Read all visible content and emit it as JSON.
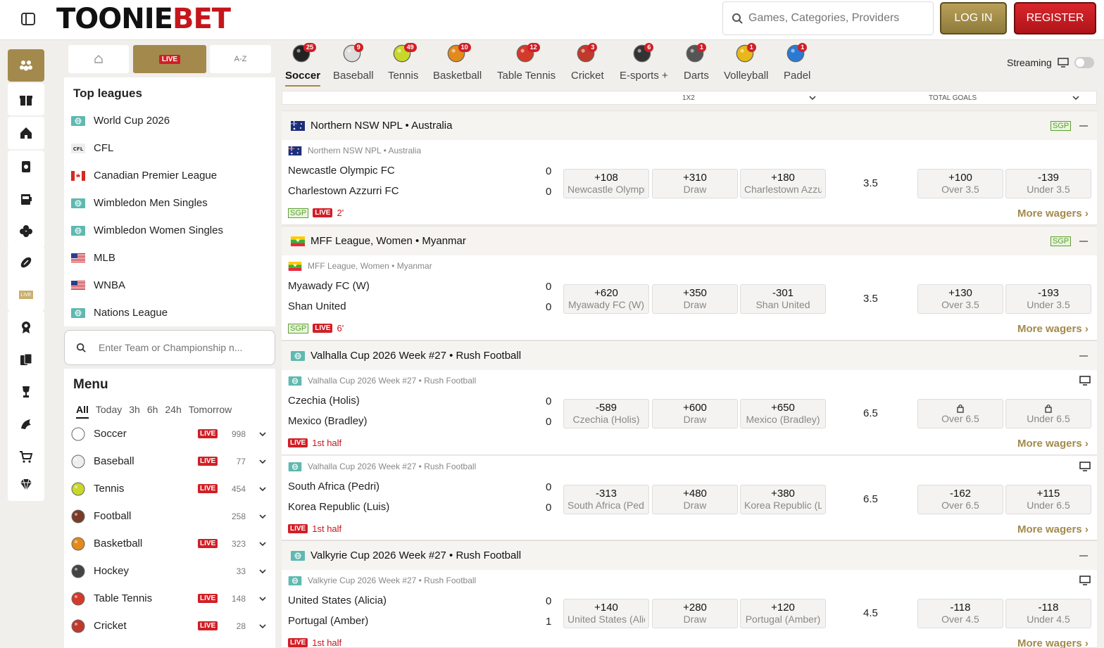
{
  "brand": {
    "logo_dark": "TOONIE",
    "logo_red": "BET"
  },
  "header": {
    "search_placeholder": "Games, Categories, Providers",
    "login_label": "LOG IN",
    "register_label": "REGISTER"
  },
  "left_tabs": {
    "live": "LIVE",
    "az": "A-Z"
  },
  "top_leagues": {
    "title": "Top leagues",
    "items": [
      {
        "label": "World Cup 2026",
        "flag": "globe-icon"
      },
      {
        "label": "CFL",
        "flag": "cfl-icon"
      },
      {
        "label": "Canadian Premier League",
        "flag": "flag-canada"
      },
      {
        "label": "Wimbledon Men Singles",
        "flag": "globe-icon"
      },
      {
        "label": "Wimbledon Women Singles",
        "flag": "globe-icon"
      },
      {
        "label": "MLB",
        "flag": "flag-usa"
      },
      {
        "label": "WNBA",
        "flag": "flag-usa"
      },
      {
        "label": "Nations League",
        "flag": "globe-icon"
      }
    ]
  },
  "team_search": {
    "placeholder": "Enter Team or Championship n..."
  },
  "menu": {
    "title": "Menu",
    "filters": [
      "All",
      "Today",
      "3h",
      "6h",
      "24h",
      "Tomorrow"
    ],
    "live_label": "LIVE",
    "sports": [
      {
        "name": "Soccer",
        "live": true,
        "count": "998",
        "color": "#ffffff"
      },
      {
        "name": "Baseball",
        "live": true,
        "count": "77",
        "color": "#eeeeee"
      },
      {
        "name": "Tennis",
        "live": true,
        "count": "454",
        "color": "#c7d82b"
      },
      {
        "name": "Football",
        "live": false,
        "count": "258",
        "color": "#7a3b2a"
      },
      {
        "name": "Basketball",
        "live": true,
        "count": "323",
        "color": "#e28a1c"
      },
      {
        "name": "Hockey",
        "live": false,
        "count": "33",
        "color": "#444444"
      },
      {
        "name": "Table Tennis",
        "live": true,
        "count": "148",
        "color": "#d33a2a"
      },
      {
        "name": "Cricket",
        "live": true,
        "count": "28",
        "color": "#c0392b"
      }
    ]
  },
  "sport_tabs": [
    {
      "label": "Soccer",
      "badge": "25",
      "color": "#222222"
    },
    {
      "label": "Baseball",
      "badge": "9",
      "color": "#dddddd"
    },
    {
      "label": "Tennis",
      "badge": "49",
      "color": "#c7d82b"
    },
    {
      "label": "Basketball",
      "badge": "10",
      "color": "#e28a1c"
    },
    {
      "label": "Table Tennis",
      "badge": "12",
      "color": "#d33a2a"
    },
    {
      "label": "Cricket",
      "badge": "3",
      "color": "#c0392b"
    },
    {
      "label": "E-sports +",
      "badge": "6",
      "color": "#333333"
    },
    {
      "label": "Darts",
      "badge": "1",
      "color": "#555555"
    },
    {
      "label": "Volleyball",
      "badge": "1",
      "color": "#e8b818"
    },
    {
      "label": "Padel",
      "badge": "1",
      "color": "#2a7ad3"
    }
  ],
  "streaming_label": "Streaming",
  "market_header": {
    "m1": "1X2",
    "m2": "TOTAL GOALS"
  },
  "sections": [
    {
      "title": "Northern NSW NPL • Australia",
      "flag": "flag-australia",
      "sgp": "SGP",
      "events": [
        {
          "sub": "Northern NSW NPL • Australia",
          "home": "Newcastle Olympic FC",
          "away": "Charlestown Azzurri FC",
          "home_score": "0",
          "away_score": "0",
          "odds": [
            {
              "odd": "+108",
              "name": "Newcastle Olympic FC"
            },
            {
              "odd": "+310",
              "name": "Draw"
            },
            {
              "odd": "+180",
              "name": "Charlestown Azzurri FC"
            }
          ],
          "line": "3.5",
          "totals": [
            {
              "odd": "+100",
              "name": "Over 3.5"
            },
            {
              "odd": "-139",
              "name": "Under 3.5"
            }
          ],
          "sgp": "SGP",
          "status": "2'",
          "more": "More wagers ›"
        }
      ]
    },
    {
      "title": "MFF League, Women • Myanmar",
      "flag": "flag-myanmar",
      "sgp": "SGP",
      "events": [
        {
          "sub": "MFF League, Women • Myanmar",
          "home": "Myawady FC (W)",
          "away": "Shan United",
          "home_score": "0",
          "away_score": "0",
          "odds": [
            {
              "odd": "+620",
              "name": "Myawady FC (W)"
            },
            {
              "odd": "+350",
              "name": "Draw"
            },
            {
              "odd": "-301",
              "name": "Shan United"
            }
          ],
          "line": "3.5",
          "totals": [
            {
              "odd": "+130",
              "name": "Over 3.5"
            },
            {
              "odd": "-193",
              "name": "Under 3.5"
            }
          ],
          "sgp": "SGP",
          "status": "6'",
          "more": "More wagers ›"
        }
      ]
    },
    {
      "title": "Valhalla Cup 2026 Week #27 • Rush Football",
      "flag": "globe-icon",
      "sgp": "",
      "events": [
        {
          "sub": "Valhalla Cup 2026 Week #27 • Rush Football",
          "home": "Czechia (Holis)",
          "away": "Mexico (Bradley)",
          "home_score": "0",
          "away_score": "0",
          "odds": [
            {
              "odd": "-589",
              "name": "Czechia (Holis)"
            },
            {
              "odd": "+600",
              "name": "Draw"
            },
            {
              "odd": "+650",
              "name": "Mexico (Bradley)"
            }
          ],
          "line": "6.5",
          "totals": [
            {
              "odd": "",
              "name": "Over 6.5",
              "locked": true
            },
            {
              "odd": "",
              "name": "Under 6.5",
              "locked": true
            }
          ],
          "sgp": "",
          "status": "1st half",
          "more": "More wagers ›"
        },
        {
          "sub": "Valhalla Cup 2026 Week #27 • Rush Football",
          "home": "South Africa (Pedri)",
          "away": "Korea Republic (Luis)",
          "home_score": "0",
          "away_score": "0",
          "odds": [
            {
              "odd": "-313",
              "name": "South Africa (Pedri)"
            },
            {
              "odd": "+480",
              "name": "Draw"
            },
            {
              "odd": "+380",
              "name": "Korea Republic (Luis)"
            }
          ],
          "line": "6.5",
          "totals": [
            {
              "odd": "-162",
              "name": "Over 6.5"
            },
            {
              "odd": "+115",
              "name": "Under 6.5"
            }
          ],
          "sgp": "",
          "status": "1st half",
          "more": "More wagers ›"
        }
      ]
    },
    {
      "title": "Valkyrie Cup 2026 Week #27 • Rush Football",
      "flag": "globe-icon",
      "sgp": "",
      "events": [
        {
          "sub": "Valkyrie Cup 2026 Week #27 • Rush Football",
          "home": "United States (Alicia)",
          "away": "Portugal (Amber)",
          "home_score": "0",
          "away_score": "1",
          "odds": [
            {
              "odd": "+140",
              "name": "United States (Alicia)"
            },
            {
              "odd": "+280",
              "name": "Draw"
            },
            {
              "odd": "+120",
              "name": "Portugal (Amber)"
            }
          ],
          "line": "4.5",
          "totals": [
            {
              "odd": "-118",
              "name": "Over 4.5"
            },
            {
              "odd": "-118",
              "name": "Under 4.5"
            }
          ],
          "sgp": "",
          "status": "1st half",
          "more": "More wagers ›"
        }
      ]
    }
  ],
  "colors": {
    "gold": "#a38a4c",
    "red": "#d11f26",
    "sgp_green": "#5aa02c"
  }
}
